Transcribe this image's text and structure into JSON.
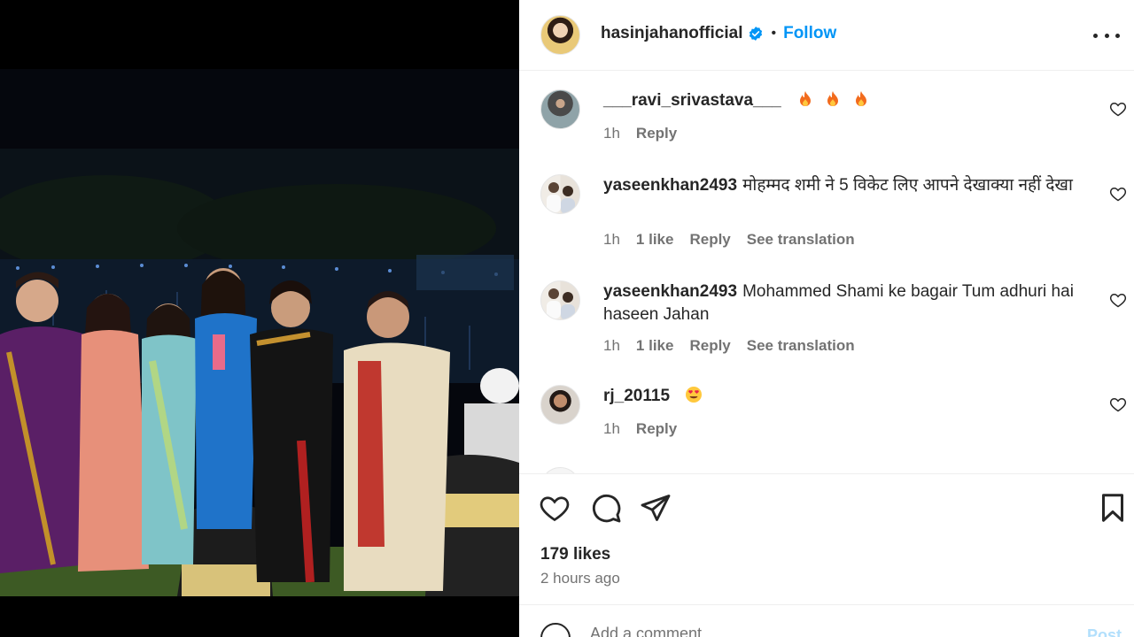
{
  "post": {
    "username": "hasinjahanofficial",
    "verified": true,
    "separator": "•",
    "follow_label": "Follow",
    "likes_text": "179 likes",
    "time_ago": "2 hours ago"
  },
  "comments": [
    {
      "username": "___ravi_srivastava___",
      "text": "",
      "emoji": "fire x3",
      "time": "1h",
      "likes": "",
      "reply": "Reply",
      "translation": ""
    },
    {
      "username": "yaseenkhan2493",
      "text": "मोहम्मद शमी ने 5 विकेट लिए आपने देखाक्या नहीं देखा",
      "time": "1h",
      "likes": "1 like",
      "reply": "Reply",
      "translation": "See translation"
    },
    {
      "username": "yaseenkhan2493",
      "text": "Mohammed Shami ke bagair Tum adhuri hai haseen Jahan",
      "time": "1h",
      "likes": "1 like",
      "reply": "Reply",
      "translation": "See translation"
    },
    {
      "username": "rj_20115",
      "text": "",
      "emoji": "heart-eyes",
      "time": "1h",
      "likes": "",
      "reply": "Reply",
      "translation": ""
    }
  ],
  "add_comment": {
    "placeholder": "Add a comment…",
    "post_label": "Post"
  },
  "icons": {
    "like": "heart-icon",
    "comment": "comment-icon",
    "share": "share-icon",
    "save": "bookmark-icon",
    "emoji": "emoji-icon",
    "more": "more-options-icon",
    "verified": "verified-badge-icon"
  },
  "colors": {
    "accent": "#0095f6",
    "text": "#262626",
    "secondary": "#737373"
  }
}
